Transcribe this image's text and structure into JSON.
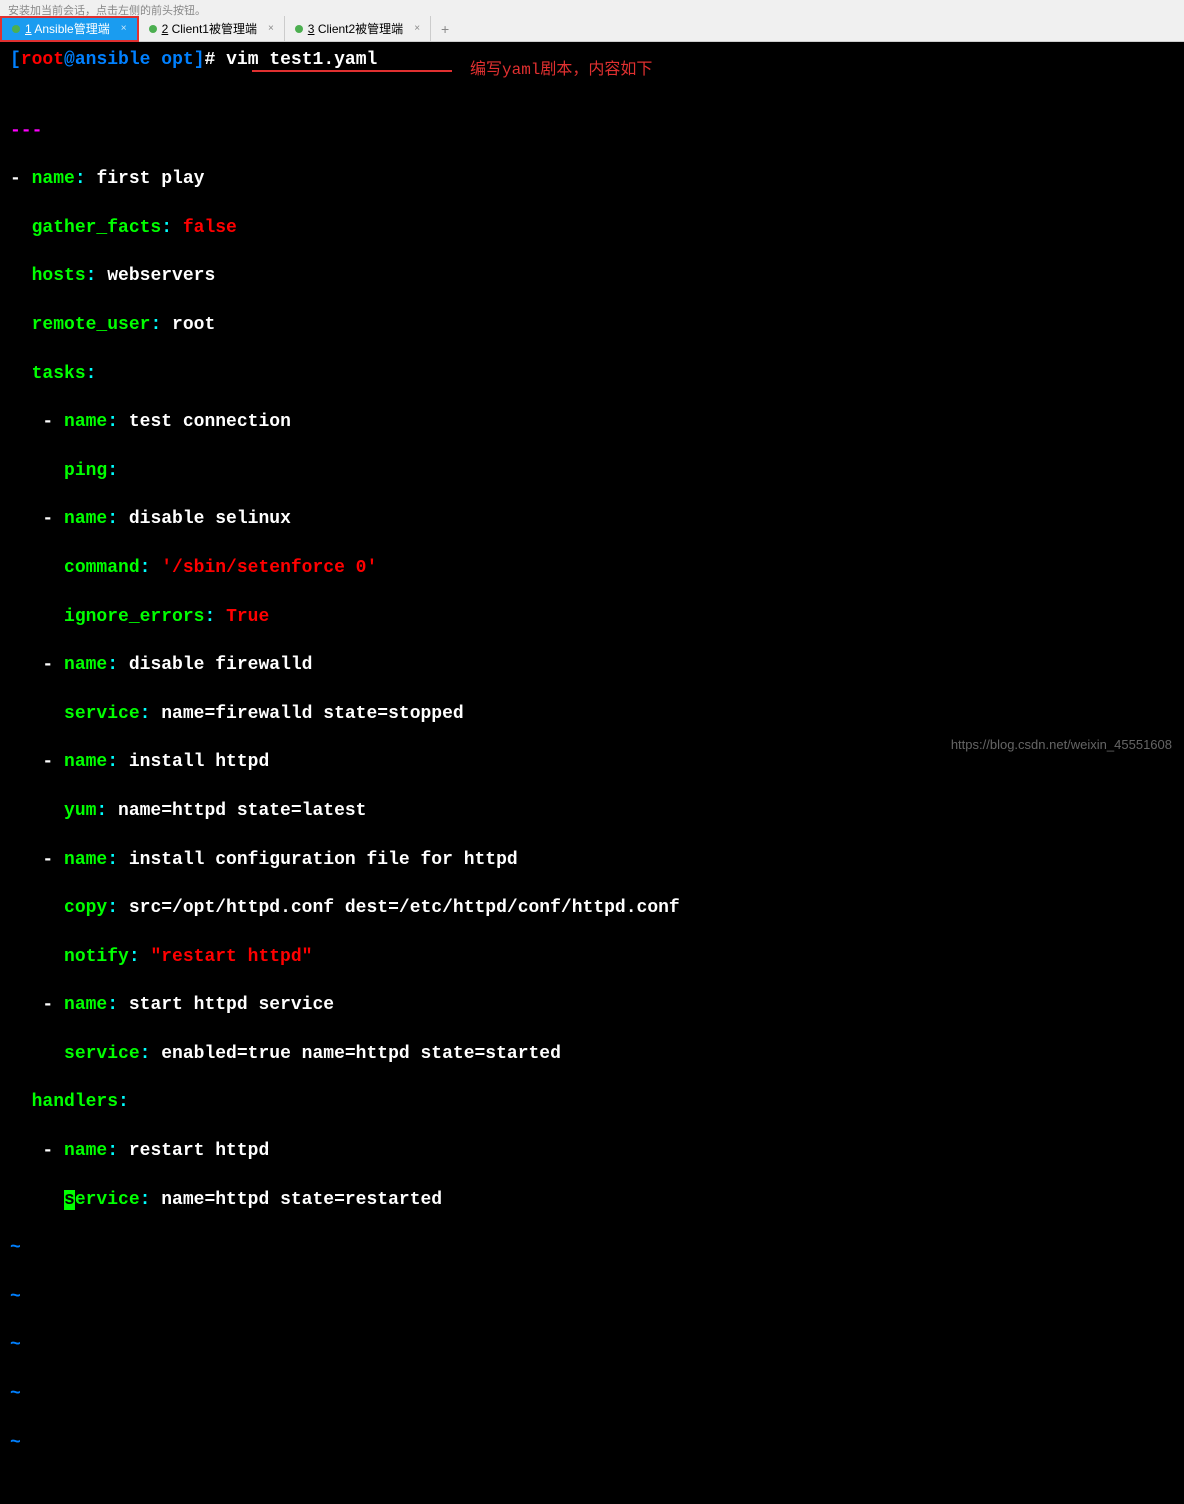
{
  "top_text": "安装加当前会话，点击左侧的前头按钮。",
  "tabs": [
    {
      "num": "1",
      "label": "Ansible管理端",
      "active": true
    },
    {
      "num": "2",
      "label": "Client1被管理端",
      "active": false
    },
    {
      "num": "3",
      "label": "Client2被管理端",
      "active": false
    }
  ],
  "prompt": {
    "user": "root",
    "host": "ansible",
    "dir": "opt",
    "command": "vim test1.yaml"
  },
  "annotation": "编写yaml剧本，内容如下",
  "yaml": {
    "doc_start": "---",
    "play": {
      "name": "first play",
      "gather_facts": "false",
      "hosts": "webservers",
      "remote_user": "root",
      "tasks": [
        {
          "name": "test connection",
          "module": "ping",
          "args": ""
        },
        {
          "name": "disable selinux",
          "module": "command",
          "args": "'/sbin/setenforce 0'",
          "ignore_errors": "True"
        },
        {
          "name": "disable firewalld",
          "module": "service",
          "args": "name=firewalld state=stopped"
        },
        {
          "name": "install httpd",
          "module": "yum",
          "args": "name=httpd state=latest"
        },
        {
          "name": "install configuration file for httpd",
          "module": "copy",
          "args": "src=/opt/httpd.conf dest=/etc/httpd/conf/httpd.conf",
          "notify": "\"restart httpd\""
        },
        {
          "name": "start httpd service",
          "module": "service",
          "args": "enabled=true name=httpd state=started"
        }
      ],
      "handlers": [
        {
          "name": "restart httpd",
          "module": "service",
          "args": "name=httpd state=restarted"
        }
      ]
    }
  },
  "watermark": "https://blog.csdn.net/weixin_45551608"
}
